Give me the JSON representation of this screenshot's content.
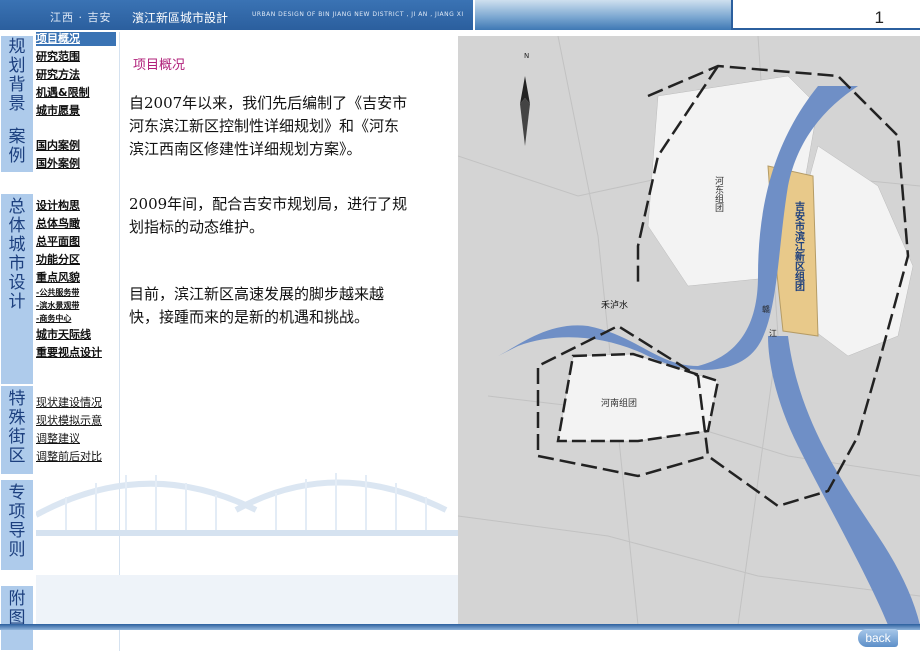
{
  "header": {
    "brand": "江西 · 吉安",
    "title_cn": "濱江新區城市設計",
    "title_en": "URBAN DESIGN OF BIN JIANG NEW DISTRICT , JI AN , JIANG XI",
    "page_number": "1"
  },
  "categories": [
    {
      "label": "规划背景"
    },
    {
      "label": "案例"
    },
    {
      "label": "总体城市设计"
    },
    {
      "label": "特殊街区"
    },
    {
      "label": "专项导则"
    },
    {
      "label": "附图"
    }
  ],
  "nav": {
    "background": [
      "项目概况",
      "研究范围",
      "研究方法",
      "机遇&限制",
      "城市愿景"
    ],
    "cases": [
      "国内案例",
      "国外案例"
    ],
    "overall": [
      "设计构思",
      "总体鸟瞰",
      "总平面图",
      "功能分区",
      "重点风貌",
      "-公共服务带",
      "-滨水景观带",
      "-商务中心",
      "城市天际线",
      "重要视点设计"
    ],
    "special": [
      "现状建设情况",
      "现状模拟示意",
      "调整建议",
      "调整前后对比"
    ]
  },
  "main": {
    "section_title": "项目概况",
    "paragraphs": [
      "自2007年以来，我们先后编制了《吉安市河东滨江新区控制性详细规划》和《河东滨江西南区修建性详细规划方案》。",
      "2009年间，配合吉安市规划局，进行了规划指标的动态维护。",
      "目前，滨江新区高速发展的脚步越来越快，接踵而来的是新的机遇和挑战。"
    ]
  },
  "map": {
    "north_label": "N",
    "labels": {
      "hedong": "河东组团",
      "binjiang": "吉安市滨江新区组团",
      "heluwater": "禾泸水",
      "henan": "河南组团",
      "gan": "赣",
      "jiang": "江"
    },
    "colors": {
      "river": "#6f8fc6",
      "highlight": "#e8c98a",
      "background": "#d4d4d4"
    }
  },
  "footer": {
    "back_label": "back"
  }
}
